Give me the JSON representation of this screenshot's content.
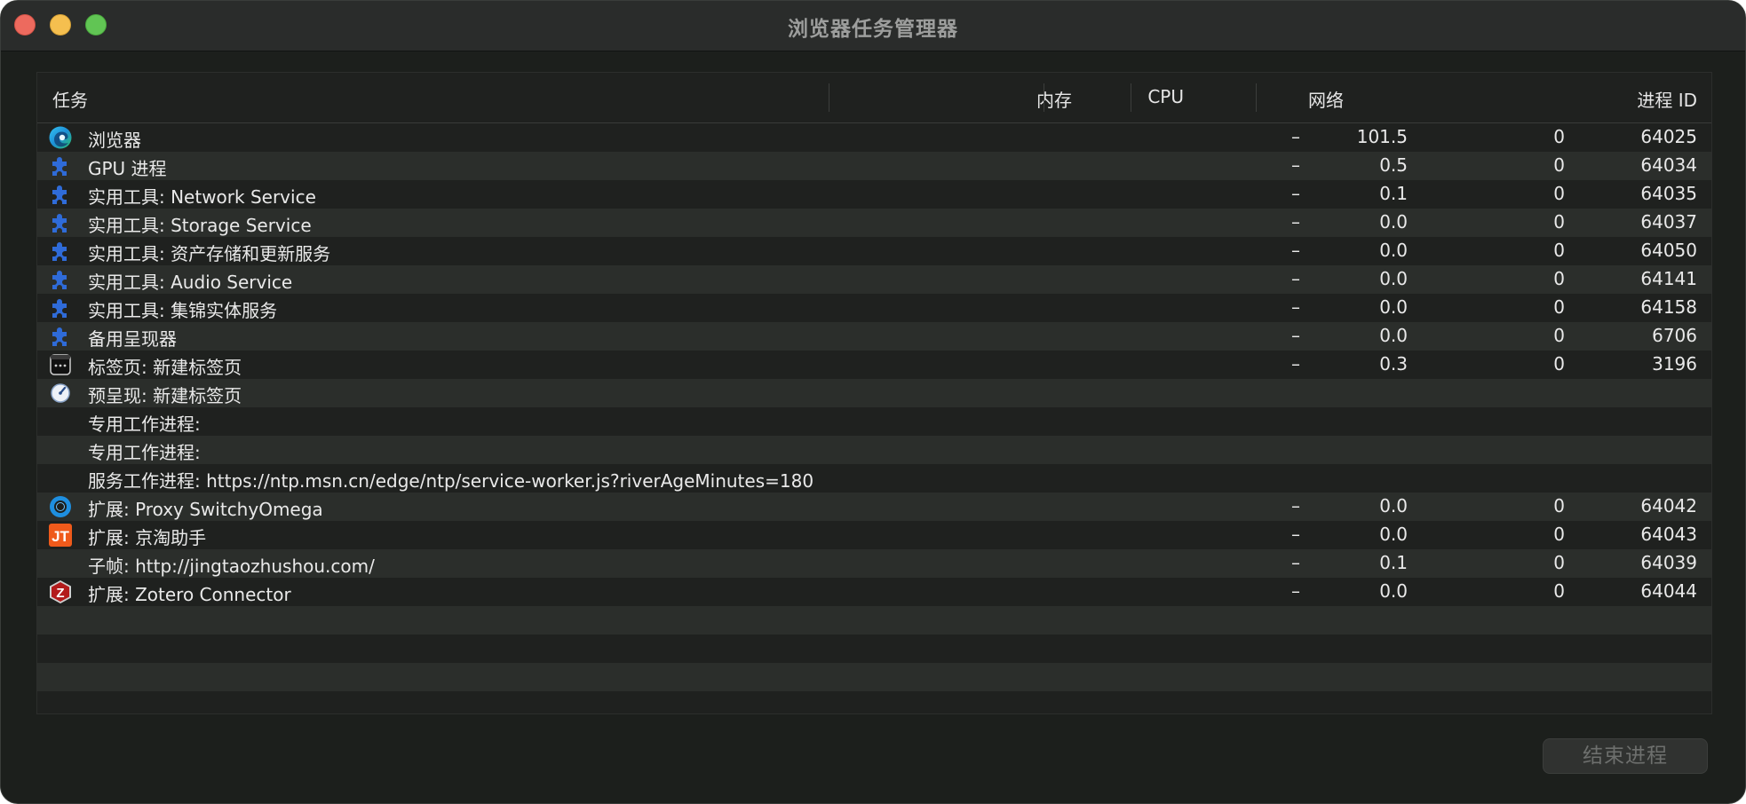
{
  "window": {
    "title": "浏览器任务管理器"
  },
  "table": {
    "headers": {
      "task": "任务",
      "memory": "内存",
      "cpu": "CPU",
      "network": "网络",
      "pid": "进程 ID"
    },
    "rows": [
      {
        "icon": "edge-browser-icon",
        "task": "浏览器",
        "memory": "–",
        "cpu": "101.5",
        "network": "0",
        "pid": "64025"
      },
      {
        "icon": "puzzle-piece-icon",
        "task": "GPU 进程",
        "memory": "–",
        "cpu": "0.5",
        "network": "0",
        "pid": "64034"
      },
      {
        "icon": "puzzle-piece-icon",
        "task": "实用工具: Network Service",
        "memory": "–",
        "cpu": "0.1",
        "network": "0",
        "pid": "64035"
      },
      {
        "icon": "puzzle-piece-icon",
        "task": "实用工具: Storage Service",
        "memory": "–",
        "cpu": "0.0",
        "network": "0",
        "pid": "64037"
      },
      {
        "icon": "puzzle-piece-icon",
        "task": "实用工具: 资产存储和更新服务",
        "memory": "–",
        "cpu": "0.0",
        "network": "0",
        "pid": "64050"
      },
      {
        "icon": "puzzle-piece-icon",
        "task": "实用工具: Audio Service",
        "memory": "–",
        "cpu": "0.0",
        "network": "0",
        "pid": "64141"
      },
      {
        "icon": "puzzle-piece-icon",
        "task": "实用工具: 集锦实体服务",
        "memory": "–",
        "cpu": "0.0",
        "network": "0",
        "pid": "64158"
      },
      {
        "icon": "puzzle-piece-icon",
        "task": "备用呈现器",
        "memory": "–",
        "cpu": "0.0",
        "network": "0",
        "pid": "6706"
      },
      {
        "icon": "new-tab-icon",
        "task": "标签页: 新建标签页",
        "memory": "–",
        "cpu": "0.3",
        "network": "0",
        "pid": "3196"
      },
      {
        "icon": "prerender-gauge-icon",
        "task": "预呈现: 新建标签页",
        "memory": "",
        "cpu": "",
        "network": "",
        "pid": ""
      },
      {
        "icon": "",
        "task": "专用工作进程:",
        "memory": "",
        "cpu": "",
        "network": "",
        "pid": ""
      },
      {
        "icon": "",
        "task": "专用工作进程:",
        "memory": "",
        "cpu": "",
        "network": "",
        "pid": ""
      },
      {
        "icon": "",
        "task": "服务工作进程: https://ntp.msn.cn/edge/ntp/service-worker.js?riverAgeMinutes=180",
        "memory": "",
        "cpu": "",
        "network": "",
        "pid": ""
      },
      {
        "icon": "proxy-switchyomega-icon",
        "task": "扩展: Proxy SwitchyOmega",
        "memory": "–",
        "cpu": "0.0",
        "network": "0",
        "pid": "64042"
      },
      {
        "icon": "jingtao-jt-icon",
        "task": "扩展: 京淘助手",
        "memory": "–",
        "cpu": "0.0",
        "network": "0",
        "pid": "64043"
      },
      {
        "icon": "",
        "task": "子帧: http://jingtaozhushou.com/",
        "memory": "–",
        "cpu": "0.1",
        "network": "0",
        "pid": "64039"
      },
      {
        "icon": "zotero-z-icon",
        "task": "扩展: Zotero Connector",
        "memory": "–",
        "cpu": "0.0",
        "network": "0",
        "pid": "64044"
      }
    ]
  },
  "actions": {
    "end_process_label": "结束进程"
  },
  "colors": {
    "window_bg": "#1c1f1c",
    "row_alt": "#2b2e2b",
    "puzzle_blue": "#2f6bd8",
    "traffic_close": "#ed6a5e",
    "traffic_min": "#f5bf4f",
    "traffic_max": "#61c554"
  }
}
